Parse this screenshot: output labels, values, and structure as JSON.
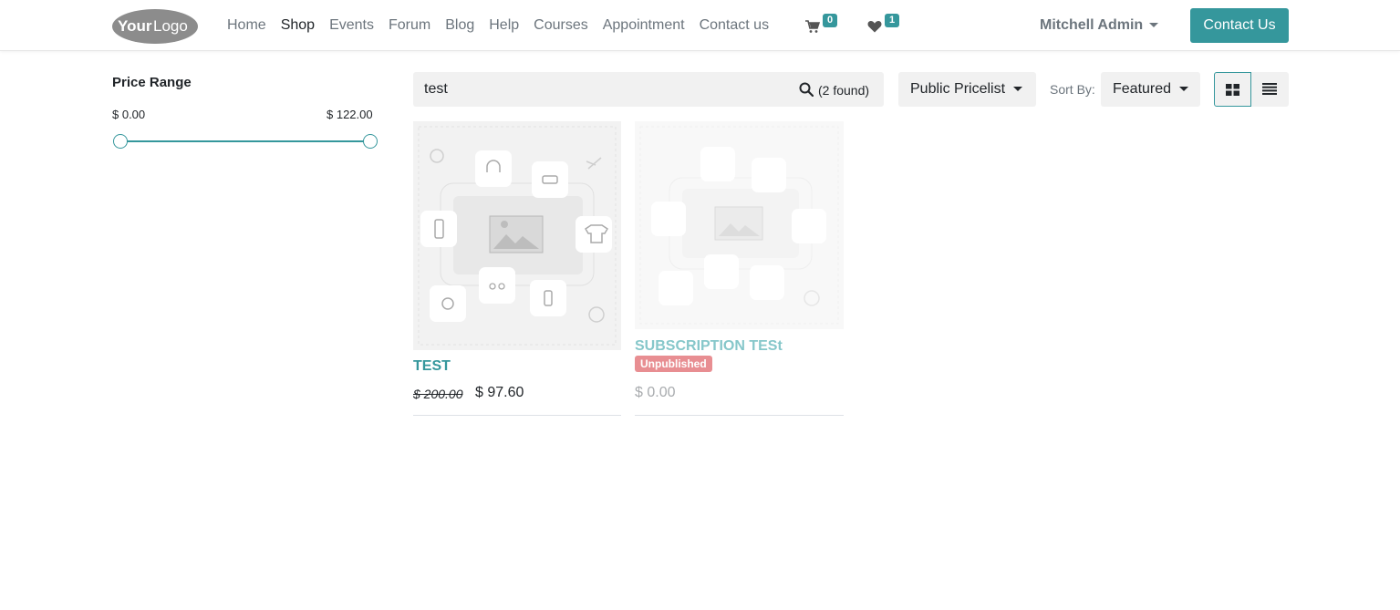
{
  "brand": {
    "logo_text": "YourLogo"
  },
  "nav": {
    "items": [
      "Home",
      "Shop",
      "Events",
      "Forum",
      "Blog",
      "Help",
      "Courses",
      "Appointment",
      "Contact us"
    ],
    "active": "Shop",
    "cart_count": "0",
    "wishlist_count": "1",
    "user": "Mitchell Admin",
    "cta": "Contact Us"
  },
  "filters": {
    "price_title": "Price Range",
    "min_label": "$ 0.00",
    "max_label": "$ 122.00"
  },
  "toolbar": {
    "search_value": "test",
    "found": "(2 found)",
    "pricelist": "Public Pricelist",
    "sort_label": "Sort By:",
    "sort_value": "Featured"
  },
  "products": [
    {
      "name": "TEST",
      "old_price": "$ 200.00",
      "price": "$ 97.60"
    },
    {
      "name": "SUBSCRIPTION TESt",
      "status": "Unpublished",
      "price": "$ 0.00"
    }
  ],
  "colors": {
    "accent": "#35979c",
    "unpublished": "#e88e92"
  }
}
